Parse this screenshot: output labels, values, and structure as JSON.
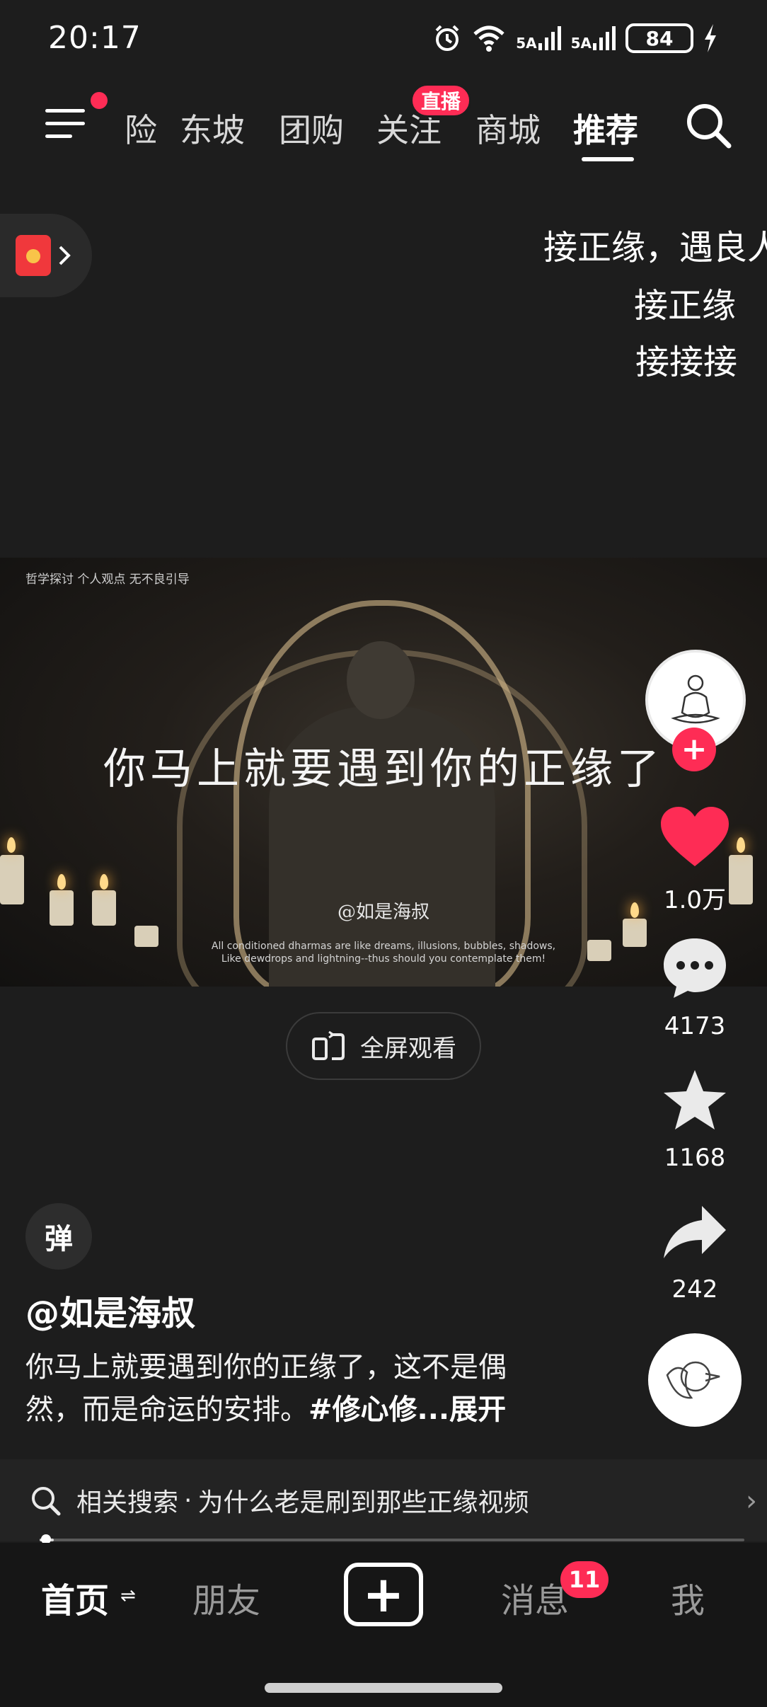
{
  "status_bar": {
    "time": "20:17",
    "network_1": "5A",
    "network_2": "5A",
    "battery": "84",
    "icons": [
      "alarm-icon",
      "wifi-icon",
      "signal-icon",
      "signal-icon",
      "battery-icon",
      "charging-icon"
    ]
  },
  "top_nav": {
    "tabs": [
      "险",
      "东坡",
      "团购",
      "关注",
      "商城",
      "推荐"
    ],
    "active_tab": "推荐",
    "live_badge": "直播"
  },
  "floating_text": [
    "接正缘，遇良人",
    "接正缘",
    "接接接"
  ],
  "video": {
    "disclaimer": "哲学探讨  个人观点  无不良引导",
    "title": "你马上就要遇到你的正缘了",
    "watermark": "@如是海叔",
    "caption_line1": "All conditioned dharmas are like dreams, illusions, bubbles, shadows,",
    "caption_line2": "Like dewdrops and lightning--thus should you contemplate them!"
  },
  "fullscreen_label": "全屏观看",
  "right_rail": {
    "likes": "1.0万",
    "comments": "4173",
    "favorites": "1168",
    "shares": "242"
  },
  "danmaku_label": "弹",
  "author": "@如是海叔",
  "description": {
    "line1": "你马上就要遇到你的正缘了，这不是偶",
    "line2_text": "然，而是命运的安排。",
    "hashtag": "#修心修",
    "more": "...展开"
  },
  "related_search": {
    "prefix": "相关搜索",
    "separator": "·",
    "query": "为什么老是刷到那些正缘视频"
  },
  "progress": 0.02,
  "bottom_nav": {
    "home": "首页",
    "friends": "朋友",
    "messages": "消息",
    "messages_badge": "11",
    "me": "我"
  },
  "colors": {
    "accent": "#fe2c55",
    "background": "#1d1d1d",
    "bottom_bar": "#161616"
  }
}
